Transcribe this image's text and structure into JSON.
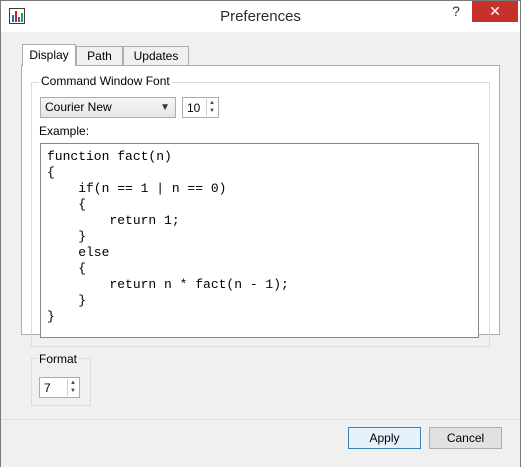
{
  "window": {
    "title": "Preferences",
    "help_glyph": "?",
    "close_glyph": "✕"
  },
  "tabs": [
    {
      "label": "Display",
      "active": true
    },
    {
      "label": "Path",
      "active": false
    },
    {
      "label": "Updates",
      "active": false
    }
  ],
  "display": {
    "font_group_label": "Command Window Font",
    "font_name": "Courier New",
    "font_size": "10",
    "example_label": "Example:",
    "example_code": "function fact(n)\n{\n    if(n == 1 | n == 0)\n    {\n        return 1;\n    }\n    else\n    {\n        return n * fact(n - 1);\n    }\n}",
    "format_label": "Format",
    "format_value": "7"
  },
  "footer": {
    "apply_label": "Apply",
    "cancel_label": "Cancel"
  },
  "icons": {
    "dropdown": "chevron-down-icon",
    "spin_up": "spin-up-icon",
    "spin_down": "spin-down-icon",
    "app": "chart-app-icon"
  },
  "colors": {
    "close_button": "#c7312b",
    "accent": "#3c7fb1"
  }
}
